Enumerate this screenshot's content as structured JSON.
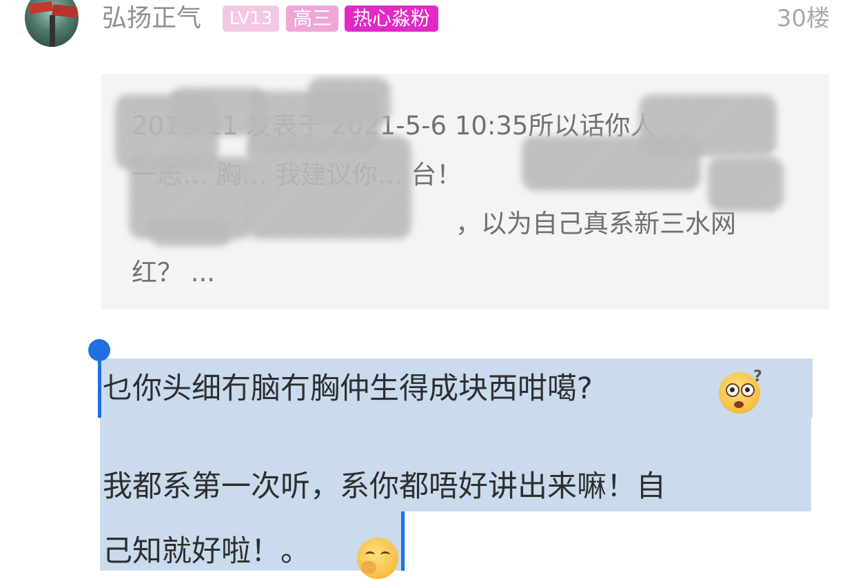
{
  "user": {
    "name": "弘扬正气",
    "badges": {
      "level": "LV13",
      "grade": "高三",
      "fan": "热心淼粉"
    },
    "floor": "30楼"
  },
  "quote": {
    "line1": "2016-11 发表于 2021-5-6 10:35所以话你人",
    "line2": "一志… 胸… 我建议你… 台！",
    "line3": "，以为自己真系新三水网",
    "line4": "红？ ..."
  },
  "reply": {
    "line1": "乜你头细冇脑冇胸仲生得成块西咁噶?",
    "line2": "我都系第一次听，系你都唔好讲出来嘛！自",
    "line3": "己知就好啦！。"
  },
  "emoji": {
    "first": "shocked-question-emoji",
    "second": "shy-smile-emoji"
  },
  "colors": {
    "badge_level": "#f3c8e4",
    "badge_grade": "#f0a6d6",
    "badge_fan": "#e229c7",
    "selection": "#cadbed",
    "cursor": "#1f6fe0",
    "quote_bg": "#f4f4f4"
  }
}
